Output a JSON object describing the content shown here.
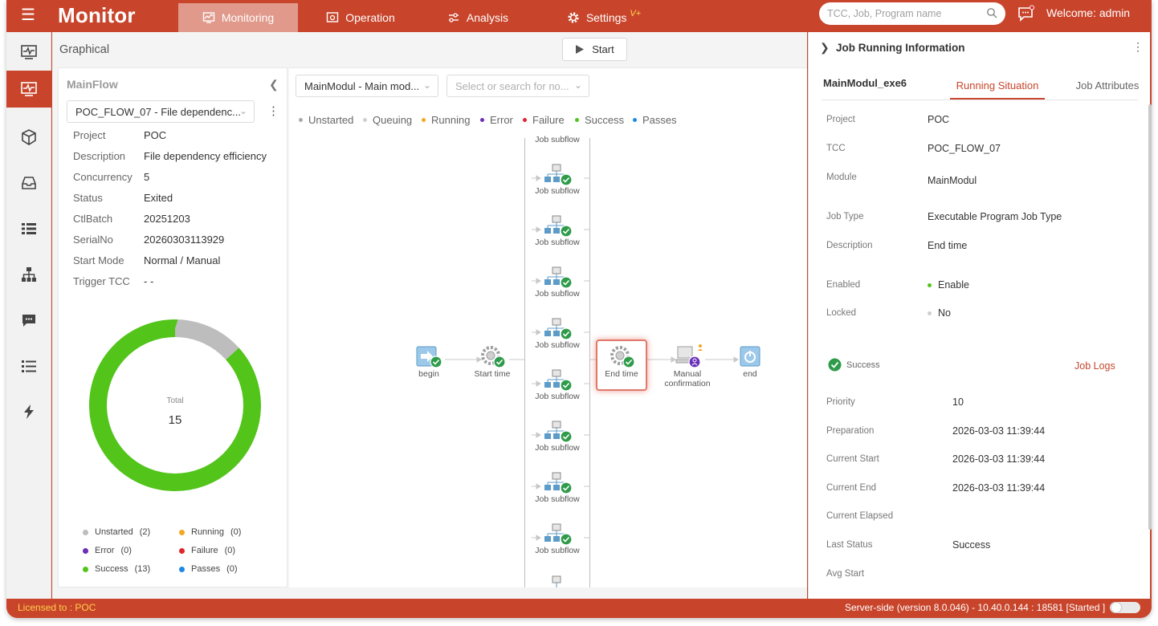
{
  "app": {
    "title": "Monitor"
  },
  "nav": {
    "tabs": [
      {
        "label": "Monitoring",
        "icon": "monitor-chart-icon",
        "active": true
      },
      {
        "label": "Operation",
        "icon": "operation-icon"
      },
      {
        "label": "Analysis",
        "icon": "analysis-icon"
      },
      {
        "label": "Settings",
        "icon": "gear-icon",
        "badge": "V+"
      }
    ],
    "search_placeholder": "TCC, Job, Program name",
    "welcome": "Welcome: admin"
  },
  "left_nav": [
    "pulse-icon",
    "monitor-icon",
    "cube-icon",
    "inbox-icon",
    "list-icon",
    "hierarchy-icon",
    "chat-icon",
    "checklist-icon",
    "bolt-icon"
  ],
  "header": {
    "view_label": "Graphical",
    "start_label": "Start"
  },
  "mainflow": {
    "title": "MainFlow",
    "selected": "POC_FLOW_07 - File dependenc...",
    "fields": [
      {
        "key": "Project",
        "value": "POC"
      },
      {
        "key": "Description",
        "value": "File dependency efficiency"
      },
      {
        "key": "Concurrency",
        "value": "5"
      },
      {
        "key": "Status",
        "value": "Exited"
      },
      {
        "key": "CtlBatch",
        "value": "20251203"
      },
      {
        "key": "SerialNo",
        "value": "20260303113929"
      },
      {
        "key": "Start Mode",
        "value": "Normal / Manual"
      },
      {
        "key": "Trigger TCC",
        "value": "- -"
      }
    ],
    "donut": {
      "total_label": "Total",
      "total": "15"
    },
    "legend": [
      {
        "label": "Unstarted",
        "count": "(2)",
        "color": "#bdbdbd"
      },
      {
        "label": "Running",
        "count": "(0)",
        "color": "#f5a623"
      },
      {
        "label": "Error",
        "count": "(0)",
        "color": "#6a2fb8"
      },
      {
        "label": "Failure",
        "count": "(0)",
        "color": "#e0242c"
      },
      {
        "label": "Success",
        "count": "(13)",
        "color": "#52c41a"
      },
      {
        "label": "Passes",
        "count": "(0)",
        "color": "#1e88e5"
      }
    ]
  },
  "chart_data": {
    "type": "pie",
    "title": "",
    "categories": [
      "Unstarted",
      "Running",
      "Error",
      "Failure",
      "Success",
      "Passes"
    ],
    "values": [
      2,
      0,
      0,
      0,
      13,
      0
    ],
    "colors": [
      "#bdbdbd",
      "#f5a623",
      "#6a2fb8",
      "#e0242c",
      "#52c41a",
      "#1e88e5"
    ]
  },
  "canvas": {
    "module_select": "MainModul - Main mod...",
    "node_search_placeholder": "Select or search for no...",
    "status_legend": [
      {
        "label": "Unstarted",
        "color": "#a9a9a9"
      },
      {
        "label": "Queuing",
        "color": "#cfcfcf"
      },
      {
        "label": "Running",
        "color": "#f5a623"
      },
      {
        "label": "Error",
        "color": "#6a2fb8"
      },
      {
        "label": "Failure",
        "color": "#e0242c"
      },
      {
        "label": "Success",
        "color": "#52c41a"
      },
      {
        "label": "Passes",
        "color": "#1e88e5"
      }
    ],
    "nodes": {
      "begin": "begin",
      "start_time": "Start time",
      "end_time": "End time",
      "manual_line1": "Manual",
      "manual_line2": "confirmation",
      "end": "end",
      "subflow": "Job subflow"
    }
  },
  "panel": {
    "title": "Job Running Information",
    "job_name": "MainModul_exe6",
    "tab_running": "Running Situation",
    "tab_attributes": "Job Attributes",
    "fields": [
      {
        "key": "Project",
        "value": "POC"
      },
      {
        "key": "TCC",
        "value": "POC_FLOW_07"
      },
      {
        "key": "Module",
        "value": "MainModul"
      },
      {
        "key": "Job Type",
        "value": "Executable Program Job Type"
      },
      {
        "key": "Description",
        "value": "End time"
      },
      {
        "key": "Enabled",
        "value": "Enable"
      },
      {
        "key": "Locked",
        "value": "No"
      }
    ],
    "status": "Success",
    "job_logs": "Job Logs",
    "run_fields": [
      {
        "key": "Priority",
        "value": "10"
      },
      {
        "key": "Preparation",
        "value": "2026-03-03 11:39:44"
      },
      {
        "key": "Current Start",
        "value": "2026-03-03 11:39:44"
      },
      {
        "key": "Current End",
        "value": "2026-03-03 11:39:44"
      },
      {
        "key": "Current Elapsed",
        "value": ""
      },
      {
        "key": "Last Status",
        "value": "Success"
      },
      {
        "key": "Avg Start",
        "value": ""
      }
    ]
  },
  "footer": {
    "licensed": "Licensed to : POC",
    "server": "Server-side  (version 8.0.046)  - 10.40.0.144 : 18581 [Started ]"
  }
}
